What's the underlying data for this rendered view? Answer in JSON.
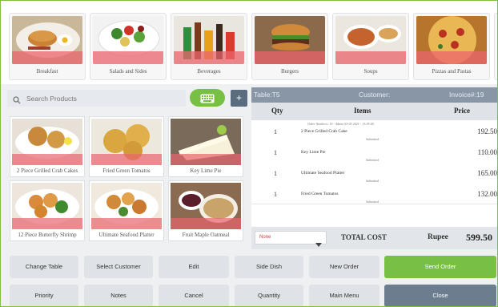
{
  "categories": [
    {
      "label": "Breakfast",
      "icon": "breakfast-plate-icon"
    },
    {
      "label": "Salads and Sides",
      "icon": "salad-plate-icon"
    },
    {
      "label": "Beverages",
      "icon": "drink-bottles-icon"
    },
    {
      "label": "Burgers",
      "icon": "burger-icon"
    },
    {
      "label": "Soups",
      "icon": "soup-bowl-icon"
    },
    {
      "label": "Pizzas and Pastas",
      "icon": "pizza-icon"
    }
  ],
  "search": {
    "placeholder": "Search Products",
    "icon": "search-icon"
  },
  "keyboard_button": {
    "icon": "keyboard-icon"
  },
  "add_button": {
    "label": "+"
  },
  "products": [
    {
      "label": "2 Piece Grilled Crab Cakes"
    },
    {
      "label": "Fried Green Tomatos"
    },
    {
      "label": "Key Lime Pie"
    },
    {
      "label": "12 Piece Butterfly Shrimp"
    },
    {
      "label": "Ultimate Seafood Platter"
    },
    {
      "label": "Fruit Maple Oatmeal"
    }
  ],
  "order": {
    "table": "Table:T5",
    "customer": "Customer:",
    "invoice": "Invoice#:19",
    "columns": {
      "qty": "Qty",
      "items": "Items",
      "price": "Price"
    },
    "header_note": "Order Numbers: 19 - Admin 03-01-2021 - 13:05:00",
    "rows": [
      {
        "qty": "1",
        "item": "2 Piece Grilled Crab Cake",
        "price": "192.50",
        "status": "Submitted"
      },
      {
        "qty": "1",
        "item": "Key Lime Pie",
        "price": "110.00",
        "status": "Submitted"
      },
      {
        "qty": "1",
        "item": "Ultimate Seafood Platter",
        "price": "165.00",
        "status": "Submitted"
      },
      {
        "qty": "1",
        "item": "Fried Green Tomatos",
        "price": "132.00",
        "status": "Submitted"
      }
    ],
    "discount_select": "None",
    "total_label": "TOTAL COST",
    "currency": "Rupee",
    "total": "599.50"
  },
  "actions": {
    "row1": [
      "Change Table",
      "Select Customer",
      "Edit",
      "Side Dish",
      "New Order",
      "Send Order"
    ],
    "row2": [
      "Priority",
      "Notes",
      "Cancel",
      "Quantity",
      "Main Menu",
      "Close"
    ]
  },
  "colors": {
    "accent_green": "#78c044",
    "header_slate": "#8896a6",
    "close_slate": "#6b7d8f",
    "food_band": "#e9646e"
  }
}
